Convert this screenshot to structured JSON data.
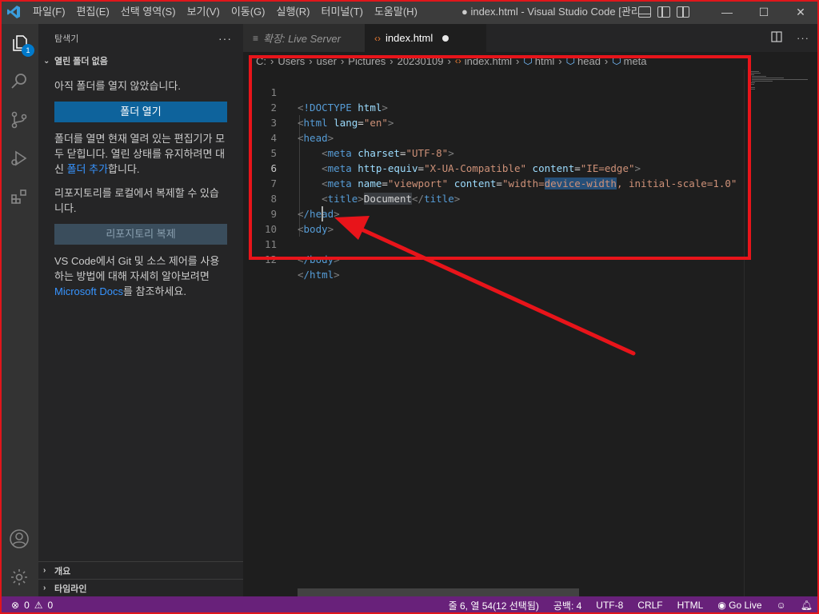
{
  "titlebar": {
    "menus": [
      "파일(F)",
      "편집(E)",
      "선택 영역(S)",
      "보기(V)",
      "이동(G)",
      "실행(R)",
      "터미널(T)",
      "도움말(H)"
    ],
    "window_title": "● index.html - Visual Studio Code [관리…",
    "controls": [
      "—",
      "☐",
      "✕"
    ]
  },
  "activity": {
    "explorer_badge": "1"
  },
  "sidebar": {
    "header": "탐색기",
    "section": "열린 폴더 없음",
    "no_folder_text": "아직 폴더를 열지 않았습니다.",
    "open_folder_button": "폴더 열기",
    "desc_1": "폴더를 열면 현재 열려 있는 편집기가 모두 닫힙니다. 열린 상태를 유지하려면 대신 ",
    "add_folder_link": "폴더 추가",
    "desc_1_end": "합니다.",
    "clone_text": "리포지토리를 로컬에서 복제할 수 있습니다.",
    "clone_button": "리포지토리 복제",
    "git_text": "VS Code에서 Git 및 소스 제어를 사용하는 방법에 대해 자세히 알아보려면 ",
    "docs_link": "Microsoft Docs",
    "git_text_end": "를 참조하세요.",
    "outline": "개요",
    "timeline": "타임라인"
  },
  "tabs": [
    {
      "label": "확장: Live Server",
      "active": false
    },
    {
      "label": "index.html",
      "active": true,
      "dirty": true
    }
  ],
  "breadcrumb": [
    "C:",
    "Users",
    "user",
    "Pictures",
    "20230109",
    "index.html",
    "html",
    "head",
    "meta"
  ],
  "editor": {
    "line_numbers": [
      "1",
      "2",
      "3",
      "4",
      "5",
      "6",
      "7",
      "8",
      "9",
      "10",
      "11",
      "12"
    ],
    "current_line": 6,
    "code": {
      "l1_tag": "!DOCTYPE",
      "l1_attr": "html",
      "l2_tag": "html",
      "l2_attr": "lang",
      "l2_val": "\"en\"",
      "l3_tag": "head",
      "l4_tag": "meta",
      "l4_attr": "charset",
      "l4_val": "\"UTF-8\"",
      "l5_tag": "meta",
      "l5_attr1": "http-equiv",
      "l5_val1": "\"X-UA-Compatible\"",
      "l5_attr2": "content",
      "l5_val2": "\"IE=edge\"",
      "l6_tag": "meta",
      "l6_attr1": "name",
      "l6_val1": "\"viewport\"",
      "l6_attr2": "content",
      "l6_val2a": "\"width=",
      "l6_val2sel": "device-width",
      "l6_val2b": ", initial-scale=1.0\"",
      "l7_tag": "title",
      "l7_text": "Document",
      "l8_tag": "/head",
      "l9_tag": "body",
      "l11_tag": "/body",
      "l12_tag": "/html"
    }
  },
  "statusbar": {
    "errors": "0",
    "warnings": "0",
    "position": "줄 6, 열 54(12 선택됨)",
    "spaces": "공백: 4",
    "encoding": "UTF-8",
    "eol": "CRLF",
    "language": "HTML",
    "go_live": "Go Live"
  },
  "colors": {
    "statusbar": "#68217a",
    "annotation": "#e8141a",
    "accent": "#007acc"
  }
}
